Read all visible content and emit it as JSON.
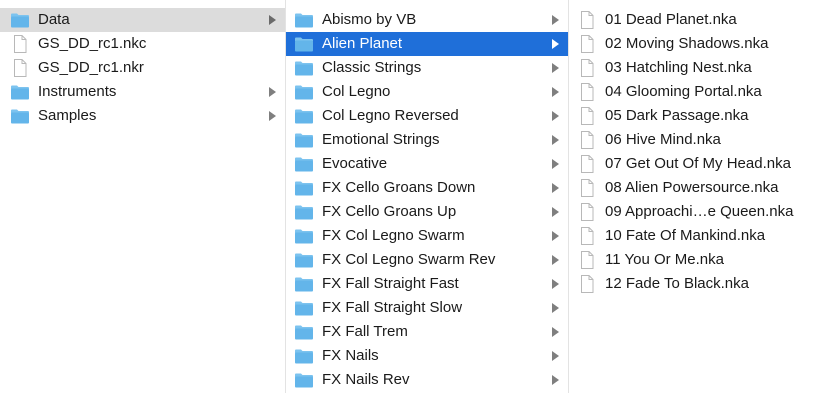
{
  "colors": {
    "folder": "#63b5ea",
    "folder_tab": "#7cc3ef",
    "selection_active": "#1f6fd9",
    "selection_inactive": "#dcdcdc"
  },
  "columns": [
    {
      "items": [
        {
          "label": "Data",
          "icon": "folder-icon",
          "has_children": true,
          "state": "selected-inactive"
        },
        {
          "label": "GS_DD_rc1.nkc",
          "icon": "document-icon",
          "has_children": false,
          "state": ""
        },
        {
          "label": "GS_DD_rc1.nkr",
          "icon": "document-icon",
          "has_children": false,
          "state": ""
        },
        {
          "label": "Instruments",
          "icon": "folder-icon",
          "has_children": true,
          "state": ""
        },
        {
          "label": "Samples",
          "icon": "folder-icon",
          "has_children": true,
          "state": ""
        }
      ]
    },
    {
      "items": [
        {
          "label": "Abismo by VB",
          "icon": "folder-icon",
          "has_children": true,
          "state": ""
        },
        {
          "label": "Alien Planet",
          "icon": "folder-icon",
          "has_children": true,
          "state": "selected-active"
        },
        {
          "label": "Classic Strings",
          "icon": "folder-icon",
          "has_children": true,
          "state": ""
        },
        {
          "label": "Col Legno",
          "icon": "folder-icon",
          "has_children": true,
          "state": ""
        },
        {
          "label": "Col Legno Reversed",
          "icon": "folder-icon",
          "has_children": true,
          "state": ""
        },
        {
          "label": "Emotional Strings",
          "icon": "folder-icon",
          "has_children": true,
          "state": ""
        },
        {
          "label": "Evocative",
          "icon": "folder-icon",
          "has_children": true,
          "state": ""
        },
        {
          "label": "FX Cello Groans Down",
          "icon": "folder-icon",
          "has_children": true,
          "state": ""
        },
        {
          "label": "FX Cello Groans Up",
          "icon": "folder-icon",
          "has_children": true,
          "state": ""
        },
        {
          "label": "FX Col Legno Swarm",
          "icon": "folder-icon",
          "has_children": true,
          "state": ""
        },
        {
          "label": "FX Col Legno Swarm Rev",
          "icon": "folder-icon",
          "has_children": true,
          "state": ""
        },
        {
          "label": "FX Fall Straight Fast",
          "icon": "folder-icon",
          "has_children": true,
          "state": ""
        },
        {
          "label": "FX Fall Straight Slow",
          "icon": "folder-icon",
          "has_children": true,
          "state": ""
        },
        {
          "label": "FX Fall Trem",
          "icon": "folder-icon",
          "has_children": true,
          "state": ""
        },
        {
          "label": "FX Nails",
          "icon": "folder-icon",
          "has_children": true,
          "state": ""
        },
        {
          "label": "FX Nails Rev",
          "icon": "folder-icon",
          "has_children": true,
          "state": ""
        }
      ]
    },
    {
      "items": [
        {
          "label": "01 Dead Planet.nka",
          "icon": "document-icon",
          "has_children": false,
          "state": ""
        },
        {
          "label": "02 Moving Shadows.nka",
          "icon": "document-icon",
          "has_children": false,
          "state": ""
        },
        {
          "label": "03 Hatchling Nest.nka",
          "icon": "document-icon",
          "has_children": false,
          "state": ""
        },
        {
          "label": "04 Glooming Portal.nka",
          "icon": "document-icon",
          "has_children": false,
          "state": ""
        },
        {
          "label": "05 Dark Passage.nka",
          "icon": "document-icon",
          "has_children": false,
          "state": ""
        },
        {
          "label": "06 Hive Mind.nka",
          "icon": "document-icon",
          "has_children": false,
          "state": ""
        },
        {
          "label": "07 Get Out Of My Head.nka",
          "icon": "document-icon",
          "has_children": false,
          "state": ""
        },
        {
          "label": "08 Alien Powersource.nka",
          "icon": "document-icon",
          "has_children": false,
          "state": ""
        },
        {
          "label": "09 Approachi…e Queen.nka",
          "icon": "document-icon",
          "has_children": false,
          "state": ""
        },
        {
          "label": "10 Fate Of Mankind.nka",
          "icon": "document-icon",
          "has_children": false,
          "state": ""
        },
        {
          "label": "11 You Or Me.nka",
          "icon": "document-icon",
          "has_children": false,
          "state": ""
        },
        {
          "label": "12 Fade To Black.nka",
          "icon": "document-icon",
          "has_children": false,
          "state": ""
        }
      ]
    }
  ]
}
